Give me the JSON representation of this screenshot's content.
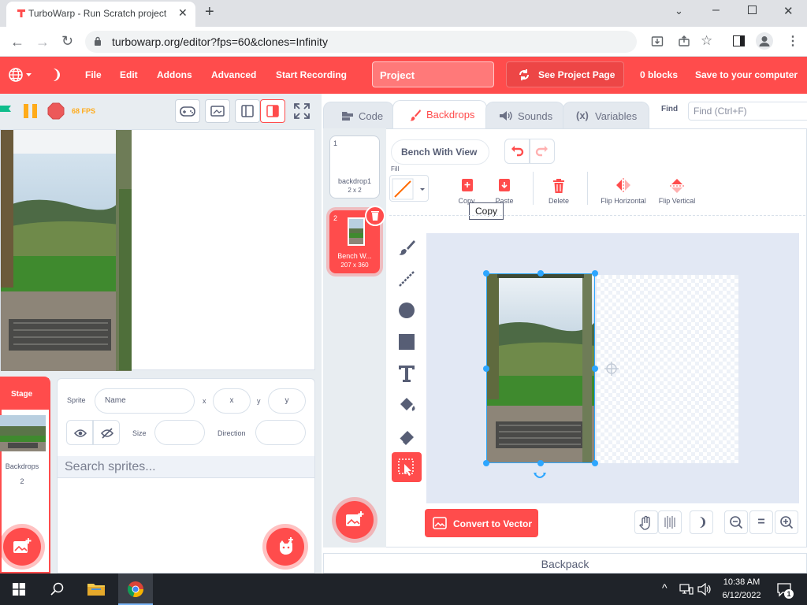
{
  "browser": {
    "tab_title": "TurboWarp - Run Scratch project",
    "url": "turbowarp.org/editor?fps=60&clones=Infinity"
  },
  "menu": {
    "items": [
      "File",
      "Edit",
      "Addons",
      "Advanced",
      "Start Recording"
    ],
    "project_title": "Project",
    "see_project_page": "See Project Page",
    "blocks_count": "0 blocks",
    "save": "Save to your computer"
  },
  "stage": {
    "fps": "68 FPS"
  },
  "tabs": {
    "code": "Code",
    "backdrops": "Backdrops",
    "sounds": "Sounds",
    "variables": "Variables",
    "find_label": "Find",
    "find_placeholder": "Find (Ctrl+F)"
  },
  "costumes": [
    {
      "num": "1",
      "name": "backdrop1",
      "size": "2 x 2"
    },
    {
      "num": "2",
      "name": "Bench W...",
      "size": "207 x 360"
    }
  ],
  "paint": {
    "costume_name": "Bench With View",
    "fill_label": "Fill",
    "copy": "Copy",
    "paste": "Paste",
    "delete": "Delete",
    "flip_h": "Flip Horizontal",
    "flip_v": "Flip Vertical",
    "tooltip": "Copy",
    "convert": "Convert to Vector",
    "zoom_reset": "="
  },
  "sprite_info": {
    "sprite_label": "Sprite",
    "name_placeholder": "Name",
    "x_label": "x",
    "x_placeholder": "x",
    "y_label": "y",
    "y_placeholder": "y",
    "size_label": "Size",
    "direction_label": "Direction",
    "search_placeholder": "Search sprites..."
  },
  "stage_panel": {
    "title": "Stage",
    "backdrops_label": "Backdrops",
    "backdrops_count": "2"
  },
  "backpack": "Backpack",
  "taskbar": {
    "time": "10:38 AM",
    "date": "6/12/2022",
    "notif_count": "1"
  },
  "colors": {
    "accent": "#ff4c4c",
    "selection": "#2da6ff",
    "go_flag": "#0fbd8c",
    "pause": "#ffab19"
  }
}
